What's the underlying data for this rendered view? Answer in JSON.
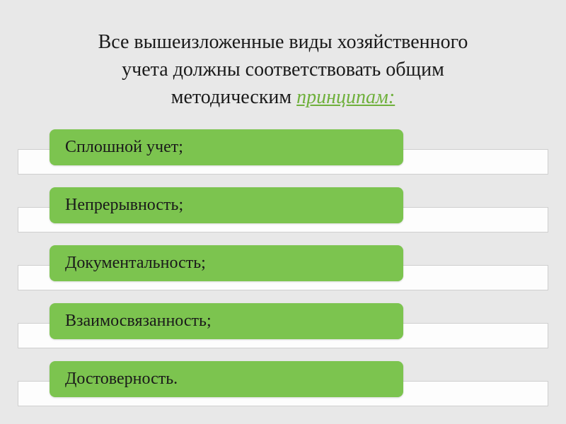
{
  "heading": {
    "line1": "Все вышеизложенные виды хозяйственного",
    "line2": "учета должны соответствовать общим",
    "line3_prefix": "методическим ",
    "line3_emphasis": "принципам:"
  },
  "items": [
    {
      "label": "Сплошной учет;"
    },
    {
      "label": "Непрерывность;"
    },
    {
      "label": "Документальность;"
    },
    {
      "label": "Взаимосвязанность;"
    },
    {
      "label": "Достоверность."
    }
  ]
}
